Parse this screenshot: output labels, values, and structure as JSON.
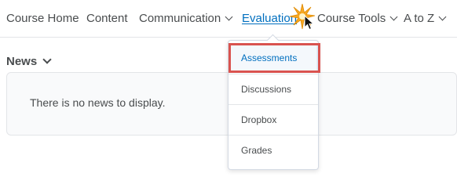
{
  "nav": {
    "items": [
      {
        "label": "Course Home",
        "has_menu": false,
        "active": false
      },
      {
        "label": "Content",
        "has_menu": false,
        "active": false
      },
      {
        "label": "Communication",
        "has_menu": true,
        "active": false
      },
      {
        "label": "Evaluation",
        "has_menu": false,
        "active": true
      },
      {
        "label": "Course Tools",
        "has_menu": true,
        "active": false
      },
      {
        "label": "A to Z",
        "has_menu": true,
        "active": false
      }
    ]
  },
  "news": {
    "title": "News",
    "empty_message": "There is no news to display."
  },
  "dropdown": {
    "items": [
      {
        "label": "Assessments",
        "highlighted": true
      },
      {
        "label": "Discussions",
        "highlighted": false
      },
      {
        "label": "Dropbox",
        "highlighted": false
      },
      {
        "label": "Grades",
        "highlighted": false
      }
    ]
  },
  "colors": {
    "text": "#494c4e",
    "link": "#006fbf",
    "highlight_border": "#d9534f",
    "panel_bg": "#f9fafb",
    "border": "#e3e5e8",
    "spark": "#f7a823"
  },
  "icons": {
    "chevron": "chevron-down-icon",
    "click": "click-spark-icon",
    "cursor": "mouse-pointer-icon"
  }
}
